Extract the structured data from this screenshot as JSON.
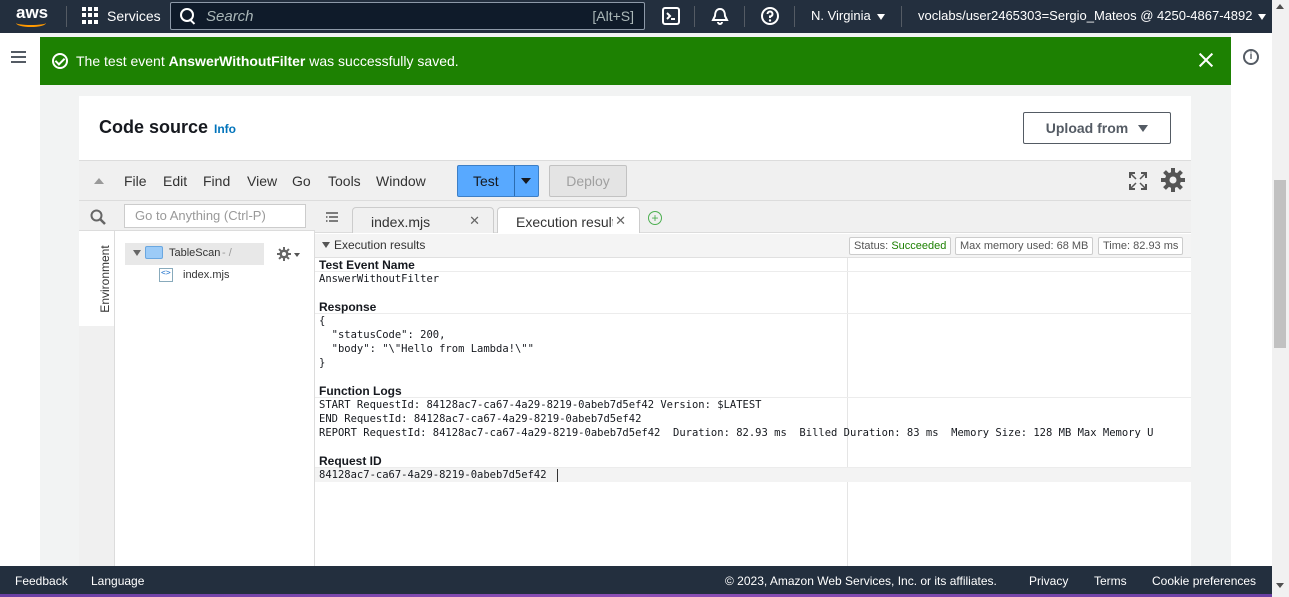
{
  "topnav": {
    "logo_text": "aws",
    "services_label": "Services",
    "search_placeholder": "Search",
    "search_shortcut": "[Alt+S]",
    "region": "N. Virginia",
    "account": "voclabs/user2465303=Sergio_Mateos @ 4250-4867-4892"
  },
  "flash": {
    "prefix": "The test event ",
    "event_name": "AnswerWithoutFilter",
    "suffix": " was successfully saved.",
    "color": "#1d8102"
  },
  "code_source": {
    "title": "Code source",
    "info_link": "Info",
    "upload_button": "Upload from"
  },
  "ide": {
    "menu": [
      "File",
      "Edit",
      "Find",
      "View",
      "Go",
      "Tools",
      "Window"
    ],
    "test_button": "Test",
    "deploy_button": "Deploy",
    "goto_placeholder": "Go to Anything (Ctrl-P)",
    "environment_label": "Environment",
    "tree": {
      "folder": "TableScan",
      "folder_suffix": "- /",
      "file": "index.mjs"
    },
    "tabs": [
      {
        "label": "index.mjs"
      },
      {
        "label": "Execution results"
      }
    ],
    "accent": "#58a9ff"
  },
  "execution": {
    "header": "Execution results",
    "status_label": "Status:",
    "status_value": "Succeeded",
    "memory": "Max memory used: 68 MB",
    "time": "Time: 82.93 ms",
    "test_event_title": "Test Event Name",
    "test_event_value": "AnswerWithoutFilter",
    "response_title": "Response",
    "response_lines": [
      "{",
      "  \"statusCode\": 200,",
      "  \"body\": \"\\\"Hello from Lambda!\\\"\"",
      "}"
    ],
    "logs_title": "Function Logs",
    "log_lines": [
      "START RequestId: 84128ac7-ca67-4a29-8219-0abeb7d5ef42 Version: $LATEST",
      "END RequestId: 84128ac7-ca67-4a29-8219-0abeb7d5ef42",
      "REPORT RequestId: 84128ac7-ca67-4a29-8219-0abeb7d5ef42  Duration: 82.93 ms  Billed Duration: 83 ms  Memory Size: 128 MB Max Memory U"
    ],
    "request_id_title": "Request ID",
    "request_id_value": "84128ac7-ca67-4a29-8219-0abeb7d5ef42"
  },
  "footer": {
    "feedback": "Feedback",
    "language": "Language",
    "copyright": "© 2023, Amazon Web Services, Inc. or its affiliates.",
    "privacy": "Privacy",
    "terms": "Terms",
    "cookies": "Cookie preferences"
  }
}
